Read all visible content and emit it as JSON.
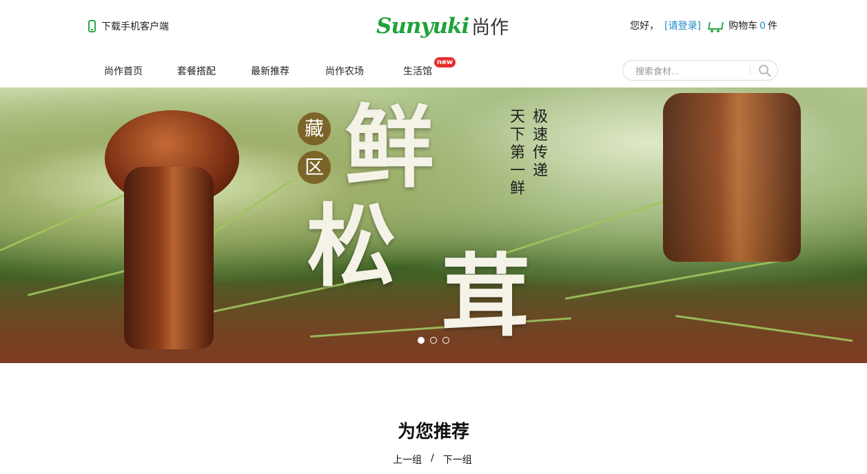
{
  "header": {
    "app_download": "下载手机客户端",
    "logo_en": "Sunyuki",
    "logo_cn": "尚作",
    "greeting": "您好，",
    "login": "[请登录]",
    "cart_label": "购物车",
    "cart_count": "0",
    "cart_unit": "件"
  },
  "nav": {
    "items": [
      {
        "label": "尚作首页"
      },
      {
        "label": "套餐搭配"
      },
      {
        "label": "最新推荐"
      },
      {
        "label": "尚作农场"
      },
      {
        "label": "生活馆"
      }
    ],
    "new_badge": "new"
  },
  "search": {
    "placeholder": "搜索食材..."
  },
  "banner": {
    "tag1": "藏",
    "tag2": "区",
    "headline_chars": [
      "鲜",
      "松",
      "茸"
    ],
    "slogan_right": "极速传递",
    "slogan_left": "天下第一鲜",
    "slide_count": 3,
    "active_slide": 1
  },
  "recommend": {
    "title": "为您推荐",
    "prev": "上一组",
    "separator": "/",
    "next": "下一组"
  },
  "colors": {
    "brand_green": "#20a33a",
    "link_blue": "#1a8bc6",
    "badge_red": "#e52f2c"
  },
  "icons": [
    "phone-icon",
    "cart-icon",
    "search-icon"
  ]
}
